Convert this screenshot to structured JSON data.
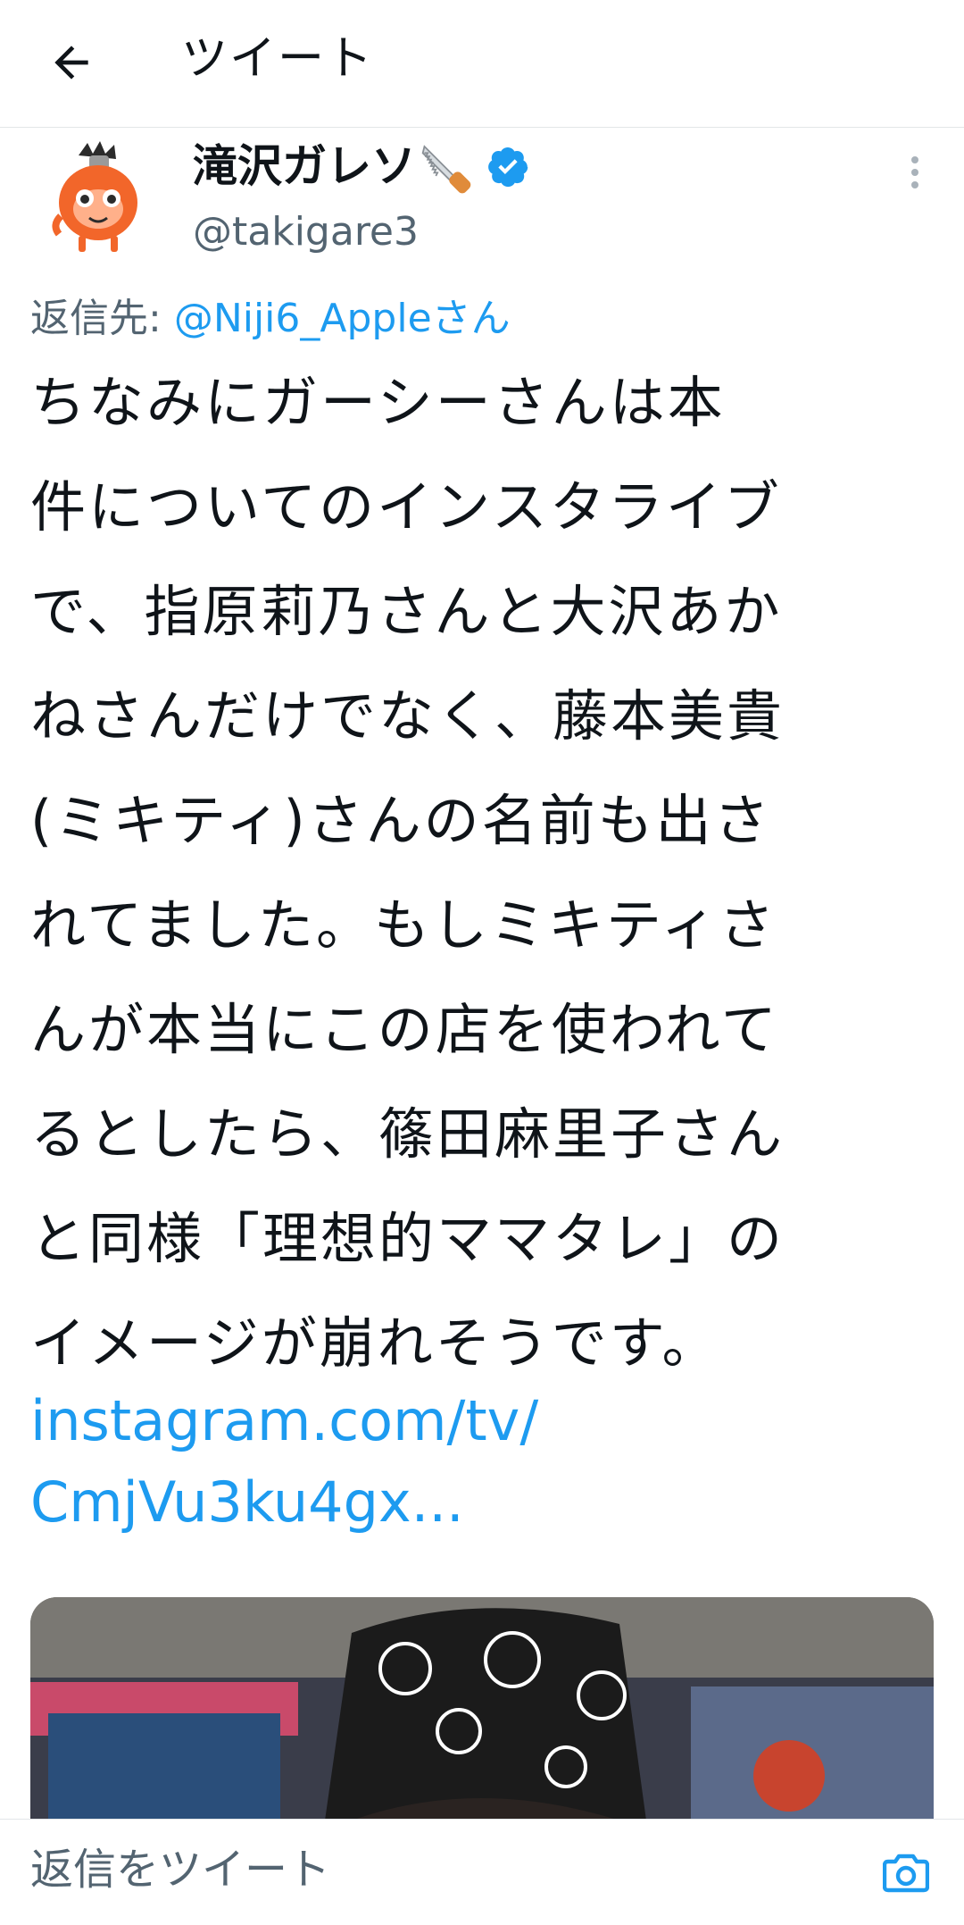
{
  "header": {
    "back_icon": "arrow-left-icon",
    "title": "ツイート"
  },
  "author": {
    "avatar": "orange-chainsaw-character-avatar",
    "display_name": "滝沢ガレソ",
    "name_emoji": "saw-emoji",
    "verified_icon": "verified-badge-icon",
    "handle": "@takigare3",
    "more_icon": "more-vertical-icon"
  },
  "reply": {
    "prefix": "返信先: ",
    "mention": "@Niji6_Appleさん"
  },
  "tweet": {
    "text": "ちなみにガーシーさんは本\n件についてのインスタライブ\nで、指原莉乃さんと大沢あか\nねさんだけでなく、藤本美貴\n(ミキティ)さんの名前も出さ\nれてました。もしミキティさ\nんが本当にこの店を使われて\nるとしたら、篠田麻里子さん\nと同様「理想的ママタレ」の\nイメージが崩れそうです。",
    "link": "instagram.com/tv/\nCmjVu3ku4gx..."
  },
  "reply_bar": {
    "placeholder": "返信をツイート",
    "camera_icon": "camera-icon"
  },
  "colors": {
    "accent": "#1d9bf0",
    "secondary_text": "#536471",
    "primary_text": "#0f1419",
    "divider": "#e3e6e8"
  }
}
